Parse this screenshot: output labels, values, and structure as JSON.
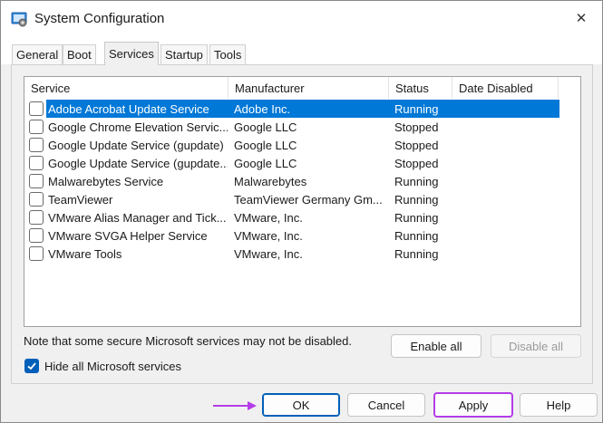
{
  "window": {
    "title": "System Configuration",
    "close_glyph": "✕"
  },
  "tabs": [
    {
      "label": "General"
    },
    {
      "label": "Boot"
    },
    {
      "label": "Services"
    },
    {
      "label": "Startup"
    },
    {
      "label": "Tools"
    }
  ],
  "active_tab": "Services",
  "services": {
    "columns": [
      "Service",
      "Manufacturer",
      "Status",
      "Date Disabled"
    ],
    "rows": [
      {
        "service": "Adobe Acrobat Update Service",
        "manufacturer": "Adobe Inc.",
        "status": "Running",
        "date_disabled": "",
        "checked": false,
        "selected": true
      },
      {
        "service": "Google Chrome Elevation Servic...",
        "manufacturer": "Google LLC",
        "status": "Stopped",
        "date_disabled": "",
        "checked": false,
        "selected": false
      },
      {
        "service": "Google Update Service (gupdate)",
        "manufacturer": "Google LLC",
        "status": "Stopped",
        "date_disabled": "",
        "checked": false,
        "selected": false
      },
      {
        "service": "Google Update Service (gupdate...",
        "manufacturer": "Google LLC",
        "status": "Stopped",
        "date_disabled": "",
        "checked": false,
        "selected": false
      },
      {
        "service": "Malwarebytes Service",
        "manufacturer": "Malwarebytes",
        "status": "Running",
        "date_disabled": "",
        "checked": false,
        "selected": false
      },
      {
        "service": "TeamViewer",
        "manufacturer": "TeamViewer Germany Gm...",
        "status": "Running",
        "date_disabled": "",
        "checked": false,
        "selected": false
      },
      {
        "service": "VMware Alias Manager and Tick...",
        "manufacturer": "VMware, Inc.",
        "status": "Running",
        "date_disabled": "",
        "checked": false,
        "selected": false
      },
      {
        "service": "VMware SVGA Helper Service",
        "manufacturer": "VMware, Inc.",
        "status": "Running",
        "date_disabled": "",
        "checked": false,
        "selected": false
      },
      {
        "service": "VMware Tools",
        "manufacturer": "VMware, Inc.",
        "status": "Running",
        "date_disabled": "",
        "checked": false,
        "selected": false
      }
    ],
    "note": "Note that some secure Microsoft services may not be disabled.",
    "enable_all_label": "Enable all",
    "disable_all_label": "Disable all",
    "hide_ms_label": "Hide all Microsoft services",
    "hide_ms_checked": true
  },
  "footer": {
    "ok_label": "OK",
    "cancel_label": "Cancel",
    "apply_label": "Apply",
    "help_label": "Help"
  },
  "colors": {
    "accent": "#005fb8",
    "selection": "#0078d7",
    "annotation": "#b43ce8"
  }
}
